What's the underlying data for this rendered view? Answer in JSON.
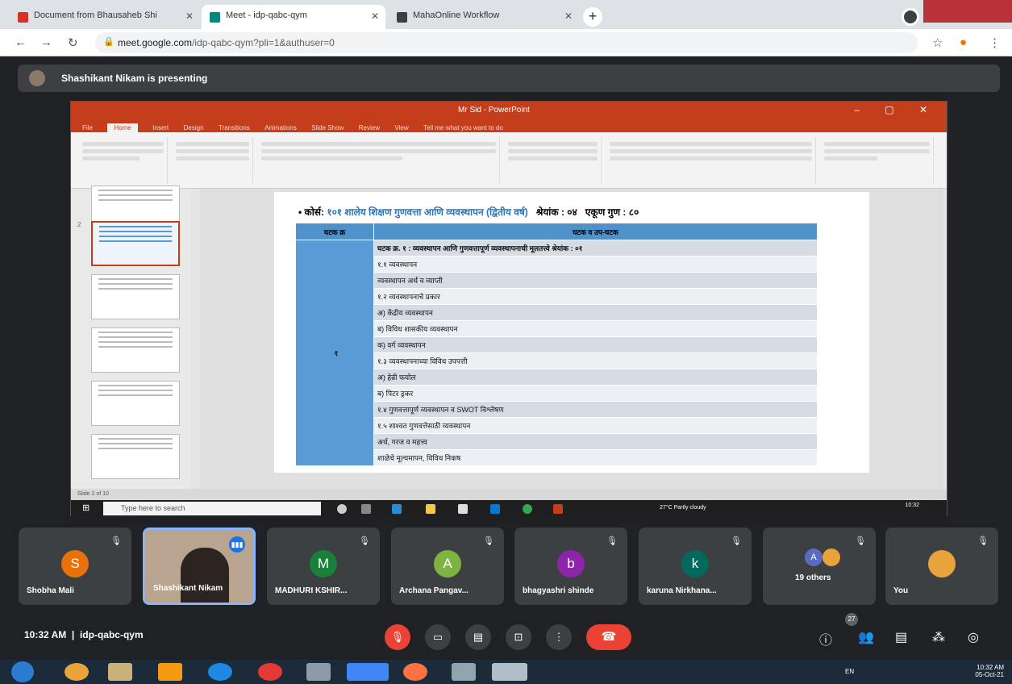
{
  "browser": {
    "tabs": [
      {
        "title": "Document from Bhausaheb Shi",
        "favicon_color": "#d93025"
      },
      {
        "title": "Meet - idp-qabc-qym",
        "favicon_color": "#00897b"
      },
      {
        "title": "MahaOnline Workflow",
        "favicon_color": "#3c4043"
      }
    ],
    "url_host": "meet.google.com",
    "url_path": "/idp-qabc-qym?pli=1&authuser=0"
  },
  "meet": {
    "presenting_banner": "Shashikant Nikam is presenting",
    "meeting_time": "10:32 AM",
    "meeting_code": "idp-qabc-qym",
    "participant_count": "27",
    "participants": [
      {
        "name": "Shobha Mali",
        "initial": "S",
        "color": "#e8710a"
      },
      {
        "name": "Shashikant Nikam",
        "initial": "",
        "color": ""
      },
      {
        "name": "MADHURI KSHIR...",
        "initial": "M",
        "color": "#188038"
      },
      {
        "name": "Archana Pangav...",
        "initial": "A",
        "color": "#7cb342"
      },
      {
        "name": "bhagyashri shinde",
        "initial": "b",
        "color": "#8e24aa"
      },
      {
        "name": "karuna Nirkhana...",
        "initial": "k",
        "color": "#00695c"
      },
      {
        "name": "19 others",
        "initial": "A",
        "color": "#5c6bc0"
      },
      {
        "name": "You",
        "initial": "",
        "color": "#e8a33a"
      }
    ]
  },
  "ppt": {
    "window_title": "Mr Sid - PowerPoint",
    "menu": [
      "File",
      "Home",
      "Insert",
      "Design",
      "Transitions",
      "Animations",
      "Slide Show",
      "Review",
      "View",
      "Tell me what you want to do"
    ],
    "active_menu": "Home",
    "status_text": "Slide 2 of 10",
    "taskbar_search": "Type here to search",
    "taskbar_tray": "27°C  Partly cloudy",
    "taskbar_time": "10:32",
    "slide": {
      "course_label": "कोर्स:",
      "course_code": "१०१",
      "course_name": "शालेय शिक्षण गुणवत्ता आणि व्यवस्थापन (द्वितीय वर्ष)",
      "marks_label": "श्रेयांक : ०४",
      "total_label": "एकूण गुण : ८०",
      "col_unit": "घटक क्र",
      "col_subunit": "घटक व उप-घटक",
      "unit_number": "१",
      "rows": [
        "घटक क्र. १ : व्यवस्थापन आणि गुणवत्तापूर्ण व्यवस्थापनाची मूलतत्त्वे श्रेयांक : ०१",
        "१.१ व्यवस्थापन",
        "व्यवस्थापन अर्थ व व्याप्ती",
        "१.२ व्यवस्थापनाचे प्रकार",
        "अ) केंद्रीय व्यवस्थापन",
        "ब) विविध शासकीय व्यवस्थापन",
        "क) वर्ग व्यवस्थापन",
        "१.३ व्यवस्थापनाच्या विविध उपपत्ती",
        "अ) हेन्री फयोल",
        "ब) पिटर ड्रकर",
        "१.४ गुणवत्तापूर्ण व्यवस्थापन व SWOT विश्लेषण",
        "१.५ शाश्वत गुणवत्तेसाठी व्यवस्थापन",
        "अर्थ, गरज व महत्त्व",
        "शाळेचे मूल्यमापन, विविध निकष"
      ]
    }
  },
  "windows": {
    "lang": "EN",
    "time": "10:32 AM",
    "date": "05-Oct-21"
  },
  "colors": {
    "ppt_brand": "#c43e1c",
    "table_header": "#4f92c9",
    "end_call": "#ea4335"
  }
}
